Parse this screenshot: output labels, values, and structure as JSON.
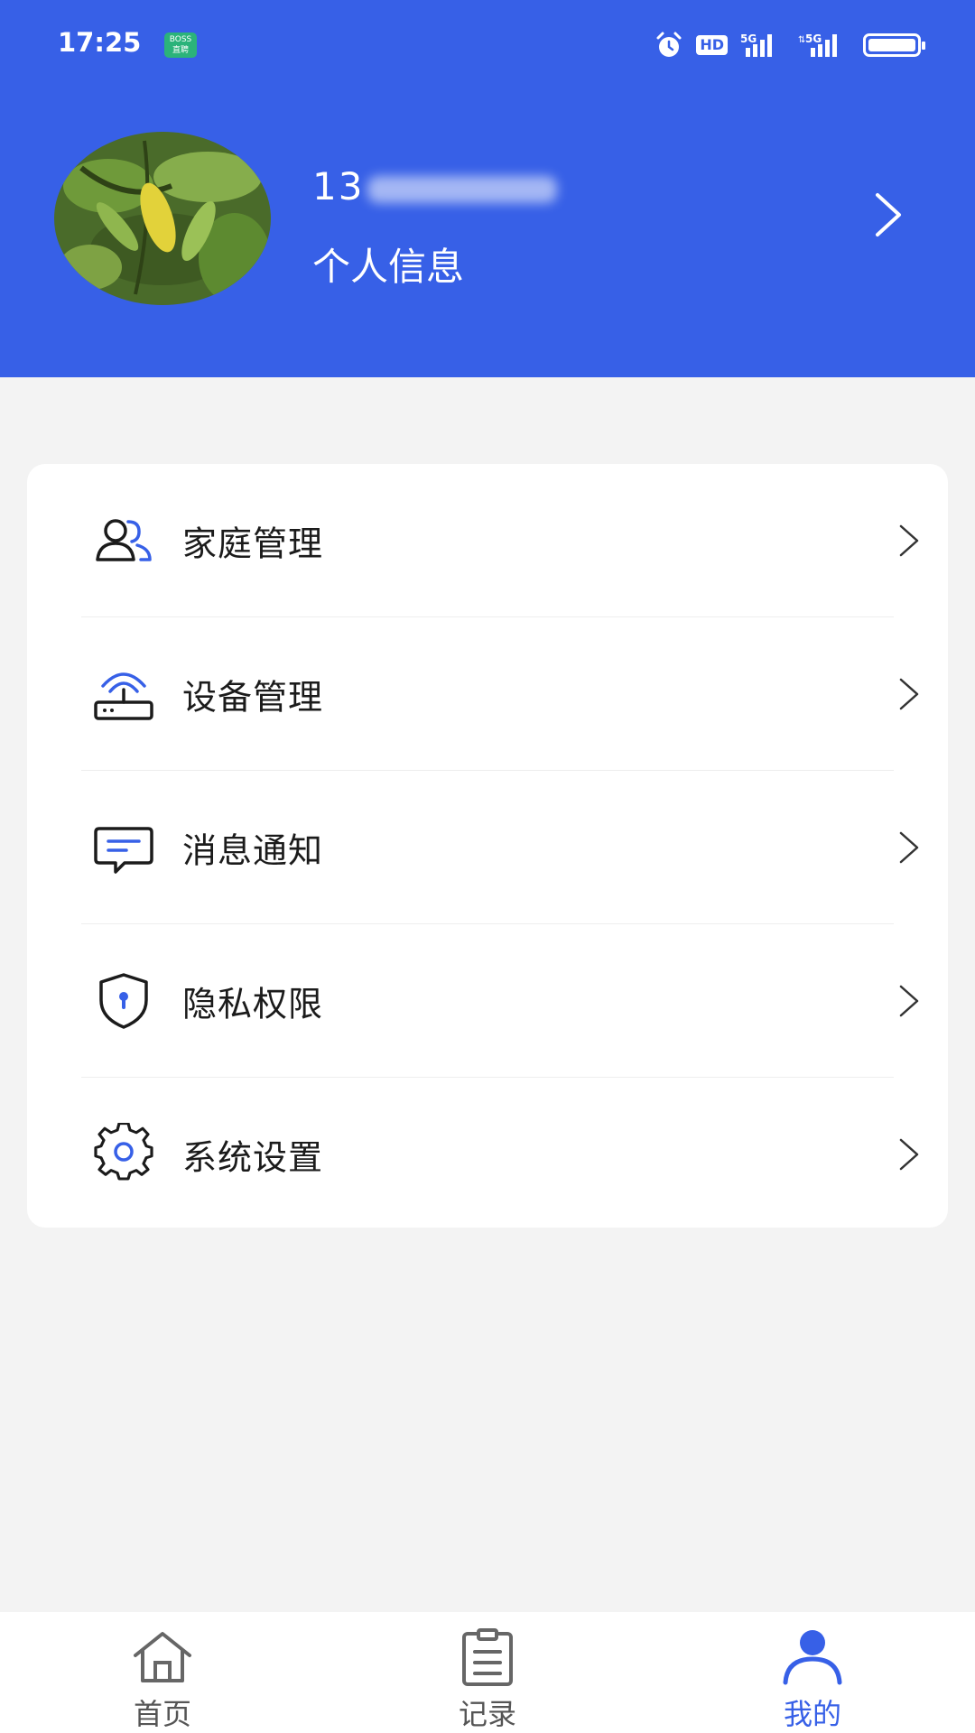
{
  "status_bar": {
    "time": "17:25",
    "app_badge": "BOSS\n直聘",
    "icons": [
      "alarm-icon",
      "hd-icon",
      "5g-signal-icon",
      "5g-signal-icon",
      "battery-icon"
    ],
    "hd_label": "HD",
    "signal1_label": "5G",
    "signal2_label": "5G"
  },
  "profile": {
    "phone": "13",
    "label": "个人信息",
    "header_color": "#3760e7"
  },
  "menu": {
    "items": [
      {
        "label": "家庭管理",
        "icon": "family-icon"
      },
      {
        "label": "设备管理",
        "icon": "router-icon"
      },
      {
        "label": "消息通知",
        "icon": "message-icon"
      },
      {
        "label": "隐私权限",
        "icon": "shield-lock-icon"
      },
      {
        "label": "系统设置",
        "icon": "gear-icon"
      }
    ]
  },
  "tabbar": {
    "tabs": [
      {
        "label": "首页",
        "icon": "home-icon",
        "active": false
      },
      {
        "label": "记录",
        "icon": "clipboard-icon",
        "active": false
      },
      {
        "label": "我的",
        "icon": "user-icon",
        "active": true
      }
    ],
    "active_color": "#3760e7"
  }
}
